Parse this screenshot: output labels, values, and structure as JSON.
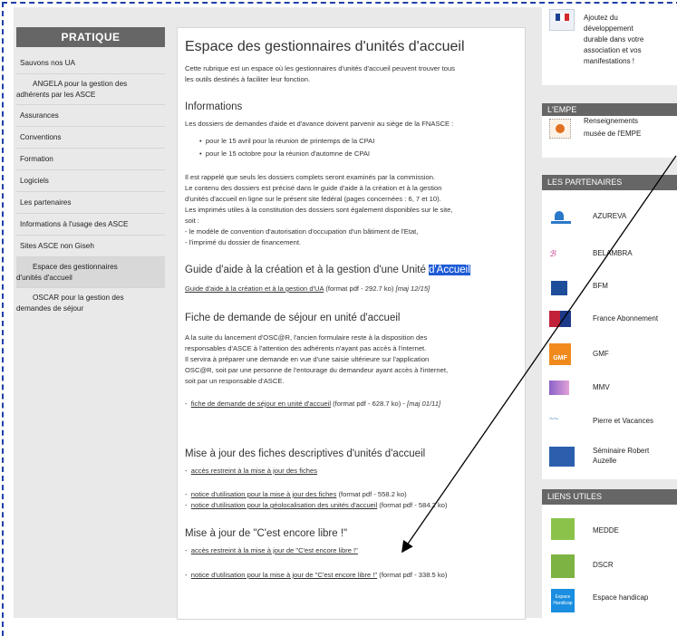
{
  "left": {
    "heading": "PRATIQUE",
    "items": [
      [
        "Sauvons nos UA"
      ],
      [
        "ANGELA pour la gestion des",
        "adhérents par les ASCE"
      ],
      [
        "Assurances"
      ],
      [
        "Conventions"
      ],
      [
        "Formation"
      ],
      [
        "Logiciels"
      ],
      [
        "Les partenaires"
      ],
      [
        "Informations à l'usage des ASCE"
      ],
      [
        "Sites ASCE non Giseh"
      ],
      [
        "Espace des gestionnaires",
        "d'unités d'accueil"
      ],
      [
        "OSCAR pour la gestion des",
        "demandes de séjour"
      ]
    ]
  },
  "main": {
    "title": "Espace des gestionnaires d'unités d'accueil",
    "intro": [
      "Cette rubrique est un espace où les gestionnaires d'unités d'accueil peuvent trouver tous",
      "les outils destinés à faciliter leur fonction."
    ],
    "info_heading": "Informations",
    "info_text": "Les dossiers de demandes d'aide et d'avance doivent parvenir au siège de la FNASCE :",
    "bullets": [
      "pour le 15 avril pour la réunion de printemps de la CPAI",
      "pour le 15 octobre pour la réunion d'automne de CPAI"
    ],
    "info_para": [
      "Il est rappelé que seuls les dossiers complets seront examinés par la commission.",
      "Le contenu des dossiers est précisé dans le guide d'aide à la création et à la gestion",
      "d'unités d'accueil en ligne sur le présent site fédéral (pages concernées : 6, 7 et 10).",
      "Les imprimés utiles à la constitution des dossiers sont également disponibles sur le site,",
      "soit :",
      "-  le modèle de convention d'autorisation d'occupation d'un bâtiment de l'Etat,",
      "-  l'imprimé du dossier de financement."
    ],
    "guide_heading_prefix": "Guide d'aide à la création et à la gestion d'une Unité",
    "guide_heading_highlight": "d'Accueil",
    "guide_link": "Guide d'aide à la création et à la gestion d'UA",
    "guide_meta": "(format pdf - 292.7 ko)",
    "guide_date": "[maj 12/15]",
    "fiche_heading": "Fiche de demande de séjour en unité d'accueil",
    "fiche_para": [
      "A la suite du lancement d'OSC@R, l'ancien formulaire reste à la disposition des",
      "responsables d'ASCE à l'attention des adhérents n'ayant pas accès à l'internet.",
      "Il servira à préparer une demande en vue d'une saisie ultérieure sur l'application",
      "OSC@R, soit par une personne de l'entourage du demandeur ayant accès à l'internet,",
      "soit par un responsable d'ASCE."
    ],
    "fiche_link": "fiche de demande de séjour en unité d'accueil",
    "fiche_meta": "(format pdf - 628.7 ko) -",
    "fiche_date": "[maj 01/11]",
    "maj_heading": "Mise à jour des fiches descriptives d'unités d'accueil",
    "maj_link1": "accès restreint à la mise à jour des fiches",
    "maj_link2": "notice d'utilisation pour la mise à jour des fiches",
    "maj_meta2": "(format pdf - 558.2 ko)",
    "maj_link3": "notice d'utilisation pour la géolocalisation des unités d'accueil",
    "maj_meta3": "(format pdf - 584.2 ko)",
    "libre_heading": "Mise à jour de \"C'est encore libre !\"",
    "libre_link1": "accès restreint à la mise à jour de \"C'est encore libre !\"",
    "libre_link2": "notice d'utilisation pour la mise à jour de \"C'est encore libre !\"",
    "libre_meta2": "(format pdf - 338.5 ko)"
  },
  "right": {
    "dev_text": [
      "Ajoutez du",
      "développement",
      "durable dans votre",
      "association et vos",
      "manifestations !"
    ],
    "empe_heading": "L'EMPE",
    "empe_text": [
      "Renseignements",
      "musée de l'EMPE"
    ],
    "partners_heading": "LES PARTENAIRES",
    "partners": [
      "AZUREVA",
      "BELAMBRA",
      "BFM",
      "France Abonnement",
      "GMF",
      "MMV",
      "Pierre et Vacances"
    ],
    "partner_last": [
      "Séminaire Robert",
      "Auzelle"
    ],
    "liens_heading": "LIENS UTILES",
    "liens": [
      "MEDDE",
      "DSCR",
      "Espace handicap"
    ],
    "logo_text": {
      "gmf": "GMF",
      "espace": [
        "Espace",
        "Handicap"
      ]
    }
  },
  "colors": {
    "header_gray": "#666666",
    "highlight": "#1e5bd6",
    "frame_blue": "#1f3fa8"
  }
}
